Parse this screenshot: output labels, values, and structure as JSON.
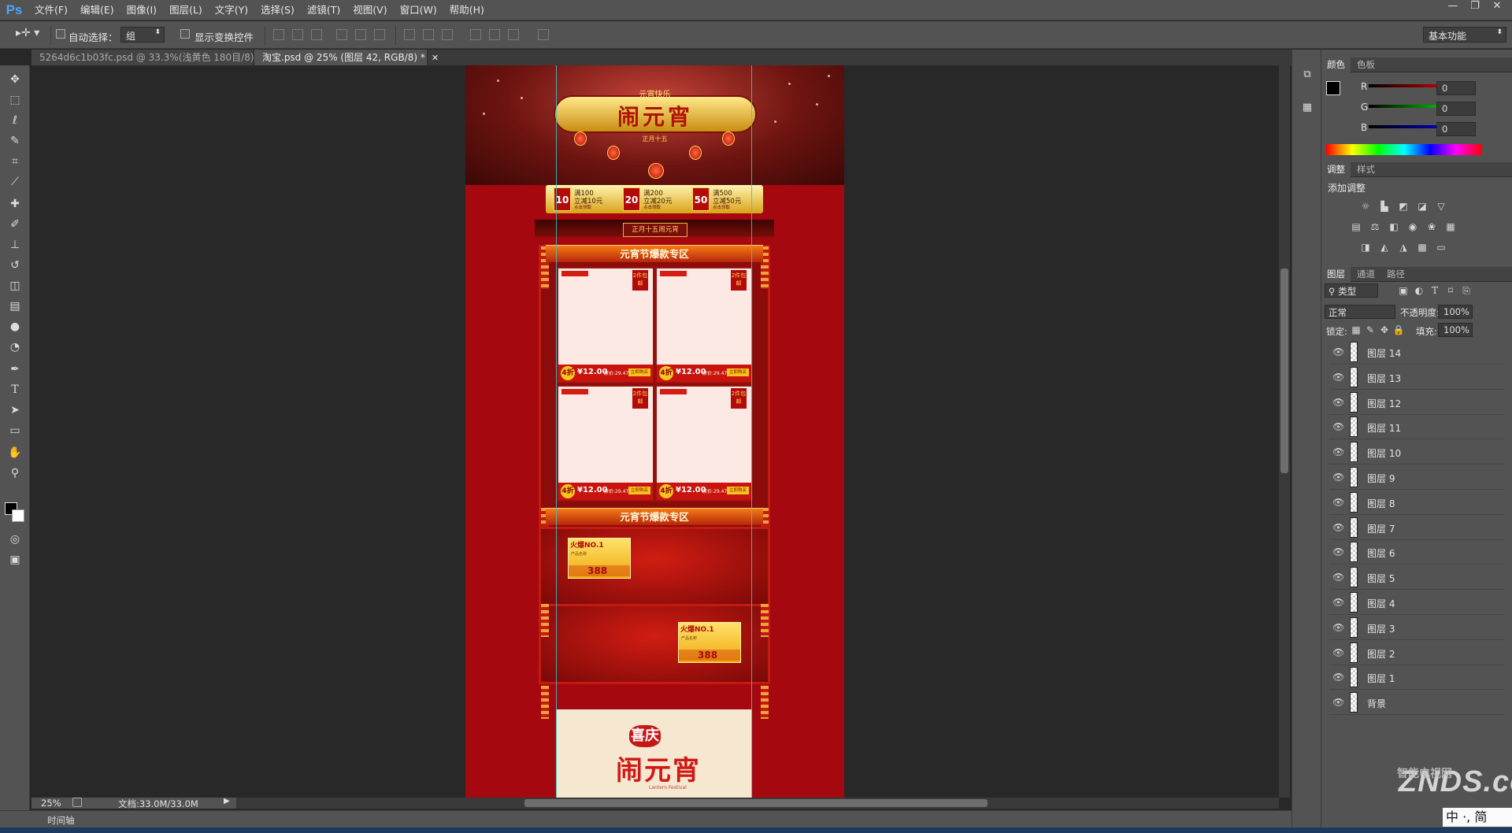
{
  "app": {
    "logo": "Ps"
  },
  "menu": [
    "文件(F)",
    "编辑(E)",
    "图像(I)",
    "图层(L)",
    "文字(Y)",
    "选择(S)",
    "滤镜(T)",
    "视图(V)",
    "窗口(W)",
    "帮助(H)"
  ],
  "window_controls": [
    "—",
    "❐",
    "✕"
  ],
  "options": {
    "auto_select_label": "自动选择：",
    "auto_select_value": "组",
    "show_transform_label": "显示变换控件",
    "workspace": "基本功能"
  },
  "tabs": [
    {
      "label": "5264d6c1b03fc.psd @ 33.3%(浅黄色 180目/8)",
      "active": false
    },
    {
      "label": "淘宝.psd @ 25% (图层 42, RGB/8) *",
      "active": true
    }
  ],
  "status": {
    "zoom": "25%",
    "doc_info": "文档:33.0M/33.0M",
    "timeline": "时间轴"
  },
  "poster": {
    "hero_sup": "元宵快乐",
    "hero_title": "闹元宵",
    "hero_tag": "正月十五",
    "coupons": [
      {
        "value": "10",
        "line1": "满100",
        "line2": "立减10元",
        "line3": "点击领取"
      },
      {
        "value": "20",
        "line1": "满200",
        "line2": "立减20元",
        "line3": "点击领取"
      },
      {
        "value": "50",
        "line1": "满500",
        "line2": "立减50元",
        "line3": "点击领取"
      }
    ],
    "plaque": "正月十五闹元宵",
    "section1": "元宵节爆款专区",
    "section2": "元宵节爆款专区",
    "product": {
      "badge": "2件包邮",
      "discount": "4折",
      "price": "¥12.00",
      "old": "原价:29.47",
      "button": "立即购买"
    },
    "hot": {
      "title": "火爆NO.1",
      "sub": "产品名称",
      "price": "388"
    },
    "festival_xi": "喜庆",
    "festival_title": "闹元宵",
    "festival_en": "Lantern Festival"
  },
  "color_panel": {
    "tabs": [
      "颜色",
      "色板"
    ],
    "channels": [
      {
        "name": "R",
        "value": "0"
      },
      {
        "name": "G",
        "value": "0"
      },
      {
        "name": "B",
        "value": "0"
      }
    ]
  },
  "adjust_panel": {
    "tabs": [
      "调整",
      "样式"
    ],
    "title": "添加调整"
  },
  "layers_panel": {
    "tabs": [
      "图层",
      "通道",
      "路径"
    ],
    "filter_kind": "类型",
    "blend_mode": "正常",
    "opacity_label": "不透明度:",
    "opacity_value": "100%",
    "lock_label": "锁定:",
    "fill_label": "填充:",
    "fill_value": "100%",
    "layers": [
      "图层 14",
      "图层 13",
      "图层 12",
      "图层 11",
      "图层 10",
      "图层 9",
      "图层 8",
      "图层 7",
      "图层 6",
      "图层 5",
      "图层 4",
      "图层 3",
      "图层 2",
      "图层 1",
      "背景"
    ]
  },
  "watermark": {
    "main": "ZNDS.com",
    "sub": "智能电视网"
  },
  "ime": "中 ·, 简"
}
